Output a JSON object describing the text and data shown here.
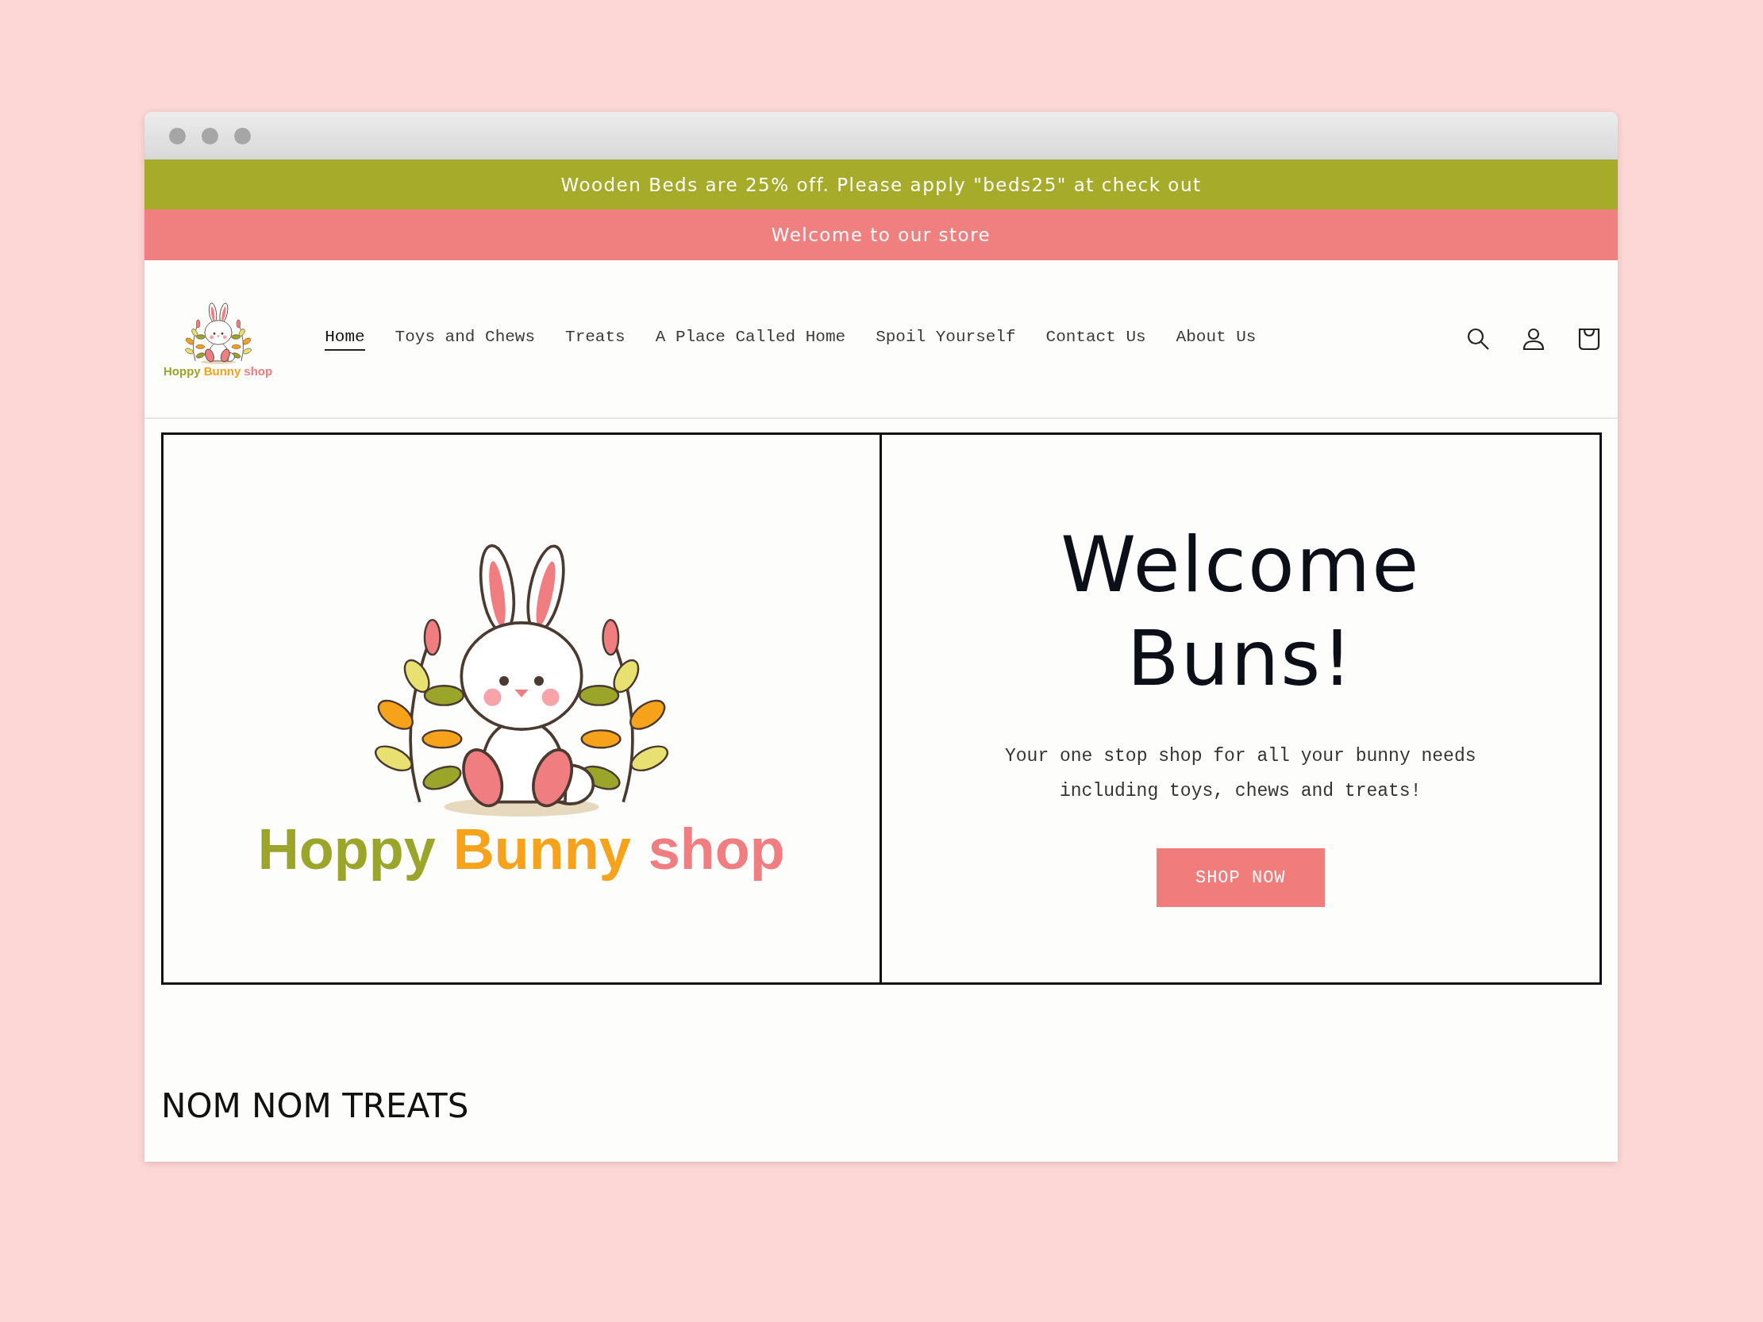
{
  "announcements": [
    {
      "text": "Wooden Beds are 25% off. Please apply \"beds25\" at check out",
      "kind": "promo"
    },
    {
      "text": "Welcome to our store",
      "kind": "welcome"
    }
  ],
  "header": {
    "logo": {
      "words": [
        {
          "text": "Hoppy",
          "color": "#9aa52a"
        },
        {
          "text": "Bunny",
          "color": "#f7a21b"
        },
        {
          "text": "shop",
          "color": "#f07d80"
        }
      ]
    },
    "nav": [
      {
        "label": "Home",
        "selected": true
      },
      {
        "label": "Toys and Chews",
        "selected": false
      },
      {
        "label": "Treats",
        "selected": false
      },
      {
        "label": "A Place Called Home",
        "selected": false
      },
      {
        "label": "Spoil Yourself",
        "selected": false
      },
      {
        "label": "Contact Us",
        "selected": false
      },
      {
        "label": "About Us",
        "selected": false
      }
    ]
  },
  "hero": {
    "logo": {
      "words": [
        {
          "text": "Hoppy",
          "color": "#9aa52a"
        },
        {
          "text": "Bunny",
          "color": "#f7a21b"
        },
        {
          "text": "shop",
          "color": "#f07d80"
        }
      ]
    },
    "heading": "Welcome Buns!",
    "text": "Your one stop shop for all your bunny needs including toys, chews and treats!",
    "button": "SHOP NOW"
  },
  "section_title": "NOM NOM TREATS"
}
